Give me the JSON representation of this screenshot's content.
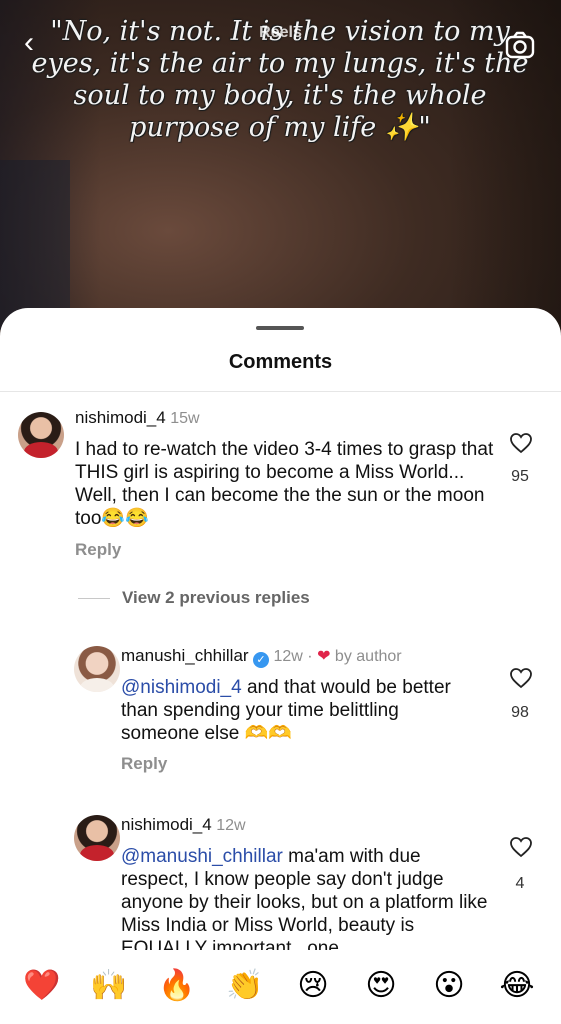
{
  "header": {
    "title": "Reels",
    "caption": "\"No, it's not. It is the vision to my eyes, it's the air to my lungs, it's the soul to my body, it's the whole purpose of my life ✨\"",
    "back_icon": "chevron-left-icon",
    "camera_icon": "camera-icon"
  },
  "sheet": {
    "title": "Comments"
  },
  "comments": [
    {
      "user": "nishimodi_4",
      "time": "15w",
      "text": "I had to re-watch the video 3-4 times to grasp that THIS girl is aspiring to become a Miss World... Well, then I can become the the sun or the moon too😂😂",
      "likes": "95",
      "reply_label": "Reply",
      "view_replies": "View 2 previous replies"
    },
    {
      "user": "manushi_chhillar",
      "verified": true,
      "time": "12w ·",
      "by_author": "by author",
      "mention": "@nishimodi_4",
      "text": " and that would be better than spending your time belittling someone else 🫶🫶",
      "likes": "98",
      "reply_label": "Reply"
    },
    {
      "user": "nishimodi_4",
      "time": "12w",
      "mention": "@manushi_chhillar",
      "text": " ma'am with due respect, I know people say don't judge anyone by their looks, but on a platform like Miss India or Miss World, beauty is EQUALLY important.. one",
      "likes": "4"
    }
  ],
  "emoji_bar": [
    "❤️",
    "🙌",
    "🔥",
    "👏",
    "😢",
    "😍",
    "😮",
    "😂"
  ],
  "colors": {
    "verified": "#3797f0",
    "mention": "#2b4da8",
    "heart_red": "#e0244a"
  }
}
